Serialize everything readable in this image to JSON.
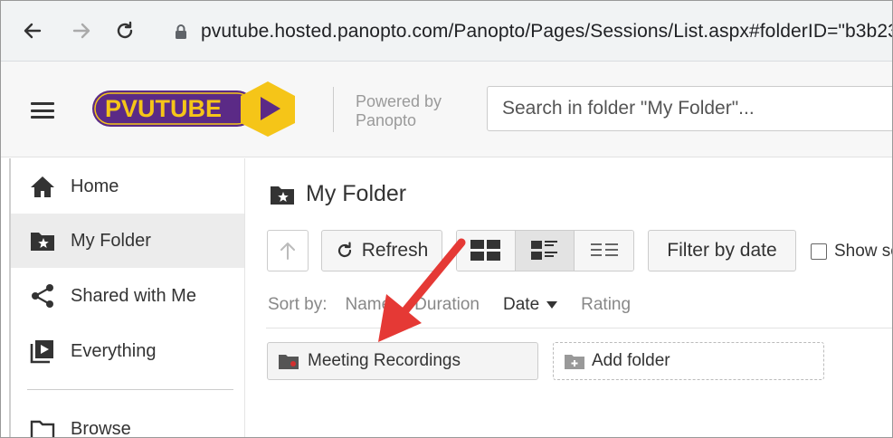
{
  "browser": {
    "url": "pvutube.hosted.panopto.com/Panopto/Pages/Sessions/List.aspx#folderID=\"b3b23"
  },
  "header": {
    "logo_text": "PVUTUBE",
    "powered_by_line1": "Powered by",
    "powered_by_line2": "Panopto",
    "search_placeholder": "Search in folder \"My Folder\"..."
  },
  "sidebar": {
    "items": [
      {
        "label": "Home",
        "icon": "home-icon"
      },
      {
        "label": "My Folder",
        "icon": "star-folder-icon",
        "active": true
      },
      {
        "label": "Shared with Me",
        "icon": "share-icon"
      },
      {
        "label": "Everything",
        "icon": "play-stack-icon"
      },
      {
        "label": "Browse",
        "icon": "folder-icon"
      }
    ]
  },
  "main": {
    "title": "My Folder",
    "toolbar": {
      "refresh_label": "Refresh",
      "filter_label": "Filter by date",
      "show_label": "Show so"
    },
    "sort": {
      "label": "Sort by:",
      "options": [
        "Name",
        "Duration",
        "Date",
        "Rating"
      ],
      "active": "Date"
    },
    "folders": [
      {
        "label": "Meeting Recordings"
      }
    ],
    "add_folder_label": "Add folder"
  },
  "colors": {
    "logo_purple": "#5b2a86",
    "logo_yellow": "#f5c518",
    "annotation_arrow": "#e53935"
  }
}
